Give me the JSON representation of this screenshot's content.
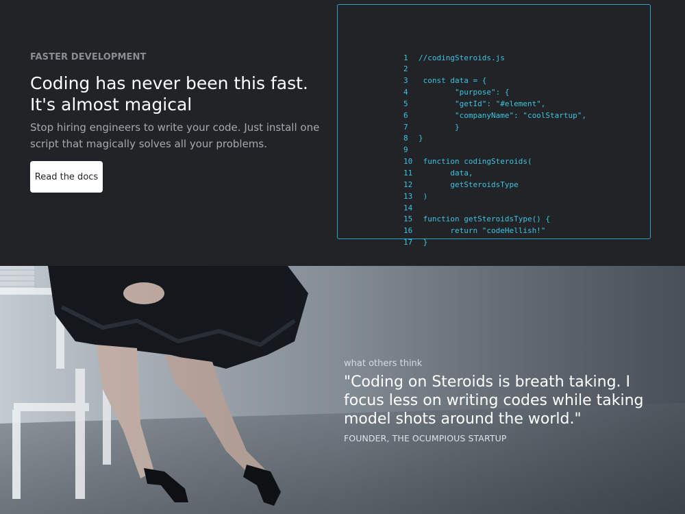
{
  "hero": {
    "eyebrow": "FASTER DEVELOPMENT",
    "headline": "Coding has never been this fast. It's almost magical",
    "lead": "Stop hiring engineers to write your code. Just install one script that magically solves all your problems.",
    "cta_label": "Read the docs"
  },
  "code": {
    "lines": [
      {
        "n": "1",
        "text": "//codingSteroids.js"
      },
      {
        "n": "2",
        "text": ""
      },
      {
        "n": "3",
        "text": " const data = {"
      },
      {
        "n": "4",
        "text": "        \"purpose\": {"
      },
      {
        "n": "5",
        "text": "        \"getId\": \"#element\","
      },
      {
        "n": "6",
        "text": "        \"companyName\": \"coolStartup\","
      },
      {
        "n": "7",
        "text": "        }"
      },
      {
        "n": "8",
        "text": "}"
      },
      {
        "n": "9",
        "text": ""
      },
      {
        "n": "10",
        "text": " function codingSteroids("
      },
      {
        "n": "11",
        "text": "       data,"
      },
      {
        "n": "12",
        "text": "       getSteroidsType"
      },
      {
        "n": "13",
        "text": " )"
      },
      {
        "n": "14",
        "text": ""
      },
      {
        "n": "15",
        "text": " function getSteroidsType() {"
      },
      {
        "n": "16",
        "text": "       return \"codeHellish!\""
      },
      {
        "n": "17",
        "text": " }"
      }
    ]
  },
  "testimonial": {
    "kicker": "what others think",
    "quote": "\"Coding on Steroids is breath taking. I focus less on writing codes while taking model shots around the world.\"",
    "author": "FOUNDER, THE OCUMPIOUS STARTUP"
  },
  "colors": {
    "background": "#212327",
    "code_accent": "#3fc3e0",
    "border_accent": "#2fa4c2"
  }
}
